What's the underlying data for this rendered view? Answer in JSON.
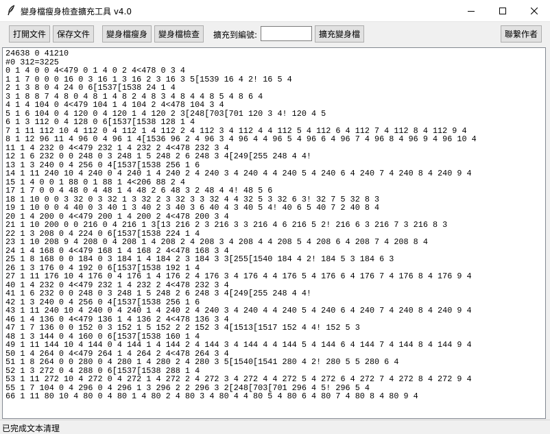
{
  "window": {
    "title": "變身檔瘦身檢查擴充工具 v4.0",
    "icon": "feather-icon"
  },
  "window_controls": {
    "minimize_icon": "minimize-icon",
    "maximize_icon": "maximize-icon",
    "close_icon": "close-icon"
  },
  "toolbar": {
    "open_label": "打開文件",
    "save_label": "保存文件",
    "slim_label": "變身檔瘦身",
    "check_label": "變身檔檢查",
    "expand_to_label": "擴充到編號:",
    "expand_to_value": "",
    "expand_label": "擴充變身檔",
    "contact_label": "聯繫作者"
  },
  "editor": {
    "lines": [
      "24638 0 41210",
      "#0 312=3225",
      "0 1 4 0 0 4<479 0 1 4 0 2 4<478 0 3 4",
      "1 1 7 0 0 0 16 0 3 16 1 3 16 2 3 16 3 5[1539 16 4 2! 16 5 4",
      "2 1 3 8 0 4 24 0 6[1537[1538 24 1 4",
      "3 1 8 8 7 4 8 0 4 8 1 4 8 2 4 8 3 4 8 4 4 8 5 4 8 6 4",
      "4 1 4 104 0 4<479 104 1 4 104 2 4<478 104 3 4",
      "5 1 6 104 0 4 120 0 4 120 1 4 120 2 3[248[703[701 120 3 4! 120 4 5",
      "6 1 3 112 0 4 128 0 6[1537[1538 128 1 4",
      "7 1 11 112 10 4 112 0 4 112 1 4 112 2 4 112 3 4 112 4 4 112 5 4 112 6 4 112 7 4 112 8 4 112 9 4",
      "8 1 12 96 11 4 96 0 4 96 1 4[1536 96 2 4 96 3 4 96 4 4 96 5 4 96 6 4 96 7 4 96 8 4 96 9 4 96 10 4",
      "11 1 4 232 0 4<479 232 1 4 232 2 4<478 232 3 4",
      "12 1 6 232 0 0 248 0 3 248 1 5 248 2 6 248 3 4[249[255 248 4 4!",
      "13 1 3 240 0 4 256 0 4[1537[1538 256 1 6",
      "14 1 11 240 10 4 240 0 4 240 1 4 240 2 4 240 3 4 240 4 4 240 5 4 240 6 4 240 7 4 240 8 4 240 9 4",
      "15 1 4 0 0 1 88 0 1 88 1 4<206 88 2 4",
      "17 1 7 0 0 4 48 0 4 48 1 4 48 2 6 48 3 2 48 4 4! 48 5 6",
      "18 1 10 0 0 3 32 0 3 32 1 3 32 2 3 32 3 3 32 4 4 32 5 3 32 6 3! 32 7 5 32 8 3",
      "19 1 10 0 0 4 40 0 3 40 1 3 40 2 3 40 3 6 40 4 3 40 5 4! 40 6 5 40 7 2 40 8 4",
      "20 1 4 200 0 4<479 200 1 4 200 2 4<478 200 3 4",
      "21 1 10 200 0 0 216 0 4 216 1 3[13 216 2 3 216 3 3 216 4 6 216 5 2! 216 6 3 216 7 3 216 8 3",
      "22 1 3 208 0 4 224 0 6[1537[1538 224 1 4",
      "23 1 10 208 9 4 208 0 4 208 1 4 208 2 4 208 3 4 208 4 4 208 5 4 208 6 4 208 7 4 208 8 4",
      "24 1 4 168 0 4<479 168 1 4 168 2 4<478 168 3 4",
      "25 1 8 168 0 0 184 0 3 184 1 4 184 2 3 184 3 3[255[1540 184 4 2! 184 5 3 184 6 3",
      "26 1 3 176 0 4 192 0 6[1537[1538 192 1 4",
      "27 1 11 176 10 4 176 0 4 176 1 4 176 2 4 176 3 4 176 4 4 176 5 4 176 6 4 176 7 4 176 8 4 176 9 4",
      "40 1 4 232 0 4<479 232 1 4 232 2 4<478 232 3 4",
      "41 1 6 232 0 0 248 0 3 248 1 5 248 2 6 248 3 4[249[255 248 4 4!",
      "42 1 3 240 0 4 256 0 4[1537[1538 256 1 6",
      "43 1 11 240 10 4 240 0 4 240 1 4 240 2 4 240 3 4 240 4 4 240 5 4 240 6 4 240 7 4 240 8 4 240 9 4",
      "46 1 4 136 0 4<479 136 1 4 136 2 4<478 136 3 4",
      "47 1 7 136 0 0 152 0 3 152 1 5 152 2 2 152 3 4[1513[1517 152 4 4! 152 5 3",
      "48 1 3 144 0 4 160 0 6[1537[1538 160 1 4",
      "49 1 11 144 10 4 144 0 4 144 1 4 144 2 4 144 3 4 144 4 4 144 5 4 144 6 4 144 7 4 144 8 4 144 9 4",
      "50 1 4 264 0 4<479 264 1 4 264 2 4<478 264 3 4",
      "51 1 8 264 0 0 280 0 4 280 1 4 280 2 4 280 3 5[1540[1541 280 4 2! 280 5 5 280 6 4",
      "52 1 3 272 0 4 288 0 6[1537[1538 288 1 4",
      "53 1 11 272 10 4 272 0 4 272 1 4 272 2 4 272 3 4 272 4 4 272 5 4 272 6 4 272 7 4 272 8 4 272 9 4",
      "55 1 7 104 0 4 296 0 4 296 1 3 296 2 2 296 3 2[248[703[701 296 4 5! 296 5 4",
      "66 1 11 80 10 4 80 0 4 80 1 4 80 2 4 80 3 4 80 4 4 80 5 4 80 6 4 80 7 4 80 8 4 80 9 4"
    ]
  },
  "status": {
    "text": "已完成文本清理"
  }
}
